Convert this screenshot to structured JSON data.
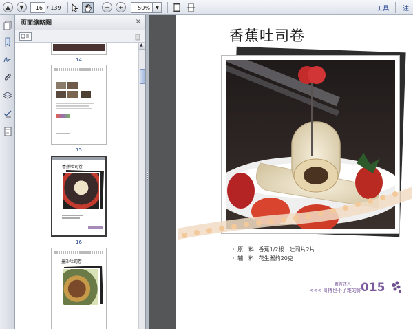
{
  "toolbar": {
    "page_current": "16",
    "page_total": "/ 139",
    "zoom": "50%",
    "tools_label": "工具",
    "comment_label": "注"
  },
  "thumbnails_panel": {
    "title": "页面缩略图",
    "pages": [
      {
        "label": "14"
      },
      {
        "label": "15"
      },
      {
        "label": "16",
        "selected": true
      },
      {
        "label": "17"
      }
    ],
    "thumb16_title": "香蕉吐司卷",
    "thumb17_title": "墨沙吐司卷"
  },
  "document": {
    "title": "香蕉吐司卷",
    "ingredients": [
      {
        "bullet": "·",
        "label": "原　料",
        "value": "香蕉1/2根　吐司片2片"
      },
      {
        "bullet": "·",
        "label": "辅　料",
        "value": "花生酱约20克"
      }
    ],
    "footer_line1": "著有还人",
    "footer_line2": "<<< 哥特也不了难的你",
    "page_number": "015"
  },
  "colors": {
    "doc_background": "#555658",
    "accent_purple": "#7b5a9e",
    "title_text": "#222222"
  }
}
